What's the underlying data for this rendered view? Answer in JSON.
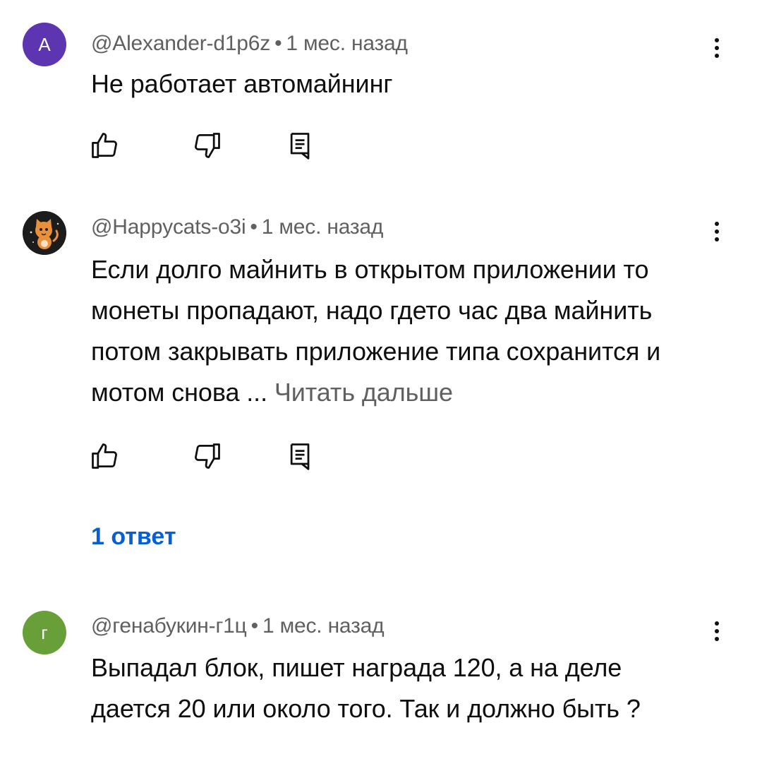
{
  "comments": [
    {
      "avatar_letter": "A",
      "avatar_color": "#5e35b1",
      "author": "@Alexander-d1p6z",
      "separator": "•",
      "time": "1 мес. назад",
      "text": "Не работает автомайнинг"
    },
    {
      "avatar_icon": "cat-avatar-icon",
      "author": "@Happycats-o3i",
      "separator": "•",
      "time": "1 мес. назад",
      "text": "Если долго майнить в открытом приложении то монеты пропадают, надо гдето час два майнить потом закрывать приложение типа сохранится и мотом снова ...",
      "read_more": "Читать дальше",
      "replies": "1 ответ"
    },
    {
      "avatar_letter": "г",
      "avatar_color": "#689f38",
      "author": "@генабукин-г1ц",
      "separator": "•",
      "time": "1 мес. назад",
      "text": "Выпадал блок, пишет награда 120, а на деле дается 20 или около того. Так и должно быть ?"
    }
  ],
  "icons": {
    "like": "thumb-up-icon",
    "dislike": "thumb-down-icon",
    "reply": "reply-comment-icon",
    "menu": "more-vert-icon"
  },
  "colors": {
    "link": "#065fd4",
    "meta": "#606060",
    "text": "#0f0f0f"
  }
}
